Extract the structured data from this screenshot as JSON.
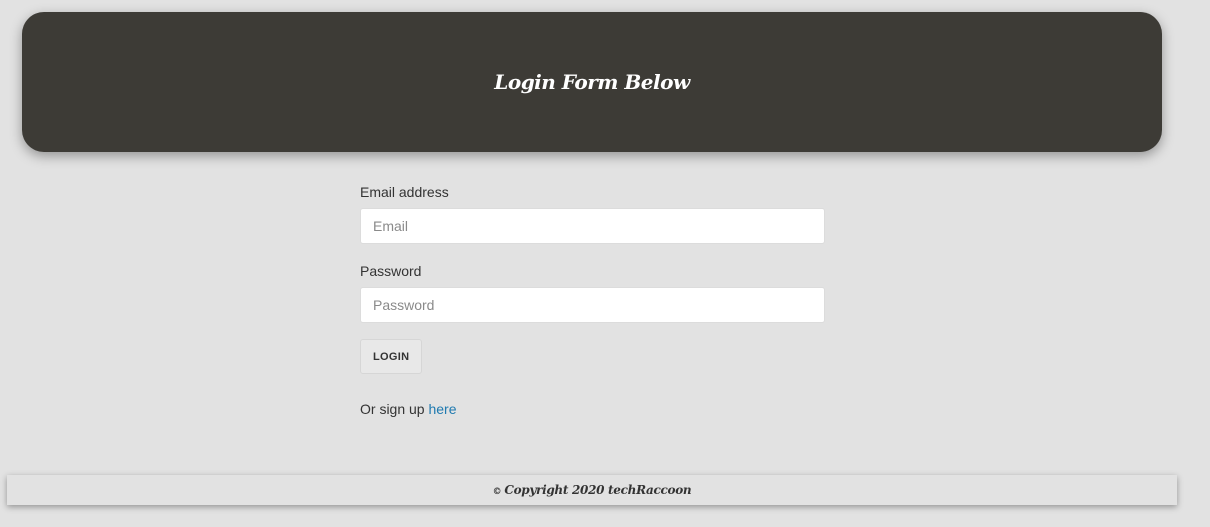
{
  "header": {
    "title": "Login Form Below"
  },
  "form": {
    "email": {
      "label": "Email address",
      "placeholder": "Email",
      "value": ""
    },
    "password": {
      "label": "Password",
      "placeholder": "Password",
      "value": ""
    },
    "login_label": "LOGIN",
    "signup_prefix": "Or sign up ",
    "signup_link": "here"
  },
  "footer": {
    "copyright_symbol": "©",
    "text": "Copyright 2020 techRaccoon"
  },
  "colors": {
    "header_bg": "#3d3b36",
    "page_bg": "#e2e2e2",
    "link": "#1f7ab0"
  }
}
